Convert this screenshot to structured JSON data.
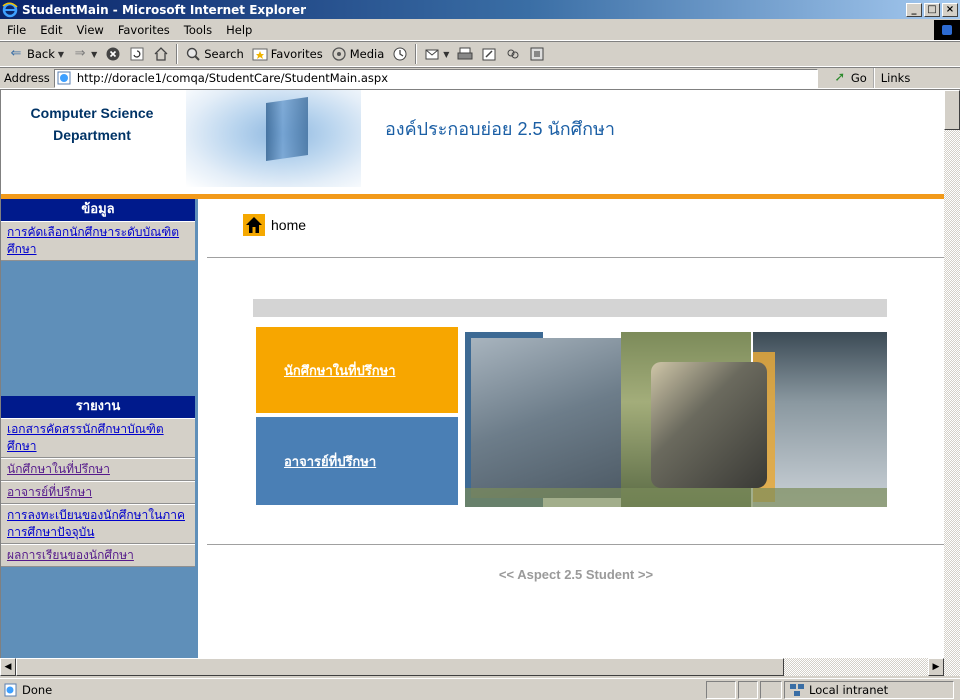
{
  "window": {
    "title": "StudentMain - Microsoft Internet Explorer",
    "controls": [
      "_",
      "□",
      "×"
    ]
  },
  "menubar": {
    "items": [
      "File",
      "Edit",
      "View",
      "Favorites",
      "Tools",
      "Help"
    ]
  },
  "toolbar": {
    "back_label": "Back",
    "search_label": "Search",
    "favorites_label": "Favorites",
    "media_label": "Media"
  },
  "addressbar": {
    "label": "Address",
    "url": "http://doracle1/comqa/StudentCare/StudentMain.aspx",
    "go_label": "Go",
    "links_label": "Links"
  },
  "header": {
    "dept_line1": "Computer Science",
    "dept_line2": "Department",
    "subtitle": "องค์ประกอบย่อย 2.5 นักศึกษา"
  },
  "sidebar": {
    "info_heading": "ข้อมูล",
    "info_items": [
      {
        "label": "การคัดเลือกนักศึกษาระดับบัณฑิตศึกษา"
      }
    ],
    "report_heading": "รายงาน",
    "report_items": [
      {
        "label": "เอกสารคัดสรรนักศึกษาบัณฑิตศึกษา"
      },
      {
        "label": "นักศึกษาในที่ปรึกษา"
      },
      {
        "label": "อาจารย์ที่ปรึกษา"
      },
      {
        "label": "การลงทะเบียนของนักศึกษาในภาคการศึกษาปัจจุบัน"
      },
      {
        "label": "ผลการเรียนของนักศึกษา"
      }
    ]
  },
  "main": {
    "home_label": "home",
    "button_students": "นักศึกษาในที่ปรึกษา",
    "button_advisors": "อาจารย์ที่ปรึกษา",
    "footer_text": "<< Aspect 2.5 Student >>"
  },
  "statusbar": {
    "status": "Done",
    "zone": "Local intranet"
  },
  "colors": {
    "orange": "#f29a1a",
    "sidebar_blue": "#5f8fb9",
    "heading_navy": "#001a8c",
    "advisor_blue": "#4a7fb5",
    "student_orange": "#f7a600"
  },
  "icons": [
    "ie-logo-icon",
    "back-icon",
    "forward-icon",
    "stop-icon",
    "refresh-icon",
    "home-icon",
    "search-icon",
    "favorites-icon",
    "media-icon",
    "history-icon",
    "mail-icon",
    "print-icon",
    "edit-icon",
    "discuss-icon",
    "messenger-icon",
    "go-icon",
    "page-icon",
    "intranet-icon"
  ]
}
